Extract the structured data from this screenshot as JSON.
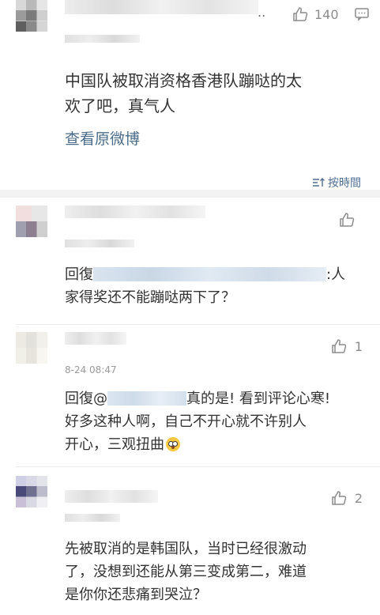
{
  "post": {
    "like_count": "140",
    "ellipsis": "..",
    "text_line1": "中国队被取消资格香港队蹦哒的太",
    "text_line2": "欢了吧，真气人",
    "view_original": "查看原微博",
    "sort_label": "按時間"
  },
  "comments": [
    {
      "like_count": "",
      "reply_prefix": "回復",
      "text_after_mention": ":人",
      "text_line2": "家得奖还不能蹦哒两下了？"
    },
    {
      "date": "8-24 08:47",
      "like_count": "1",
      "reply_prefix": "回復@",
      "text_after_mention": "真的是! 看到评论心寒!",
      "text_line2": "好多这种人啊，自己不开心就不许别人",
      "text_line3": "开心，三观扭曲"
    },
    {
      "like_count": "2",
      "text_line1": "先被取消的是韩国队，当时已经很激动",
      "text_line2": "了，没想到还能从第三变成第二，难道",
      "text_line3": "是你你还悲痛到哭泣？"
    }
  ],
  "icons": {
    "like": "thumbs-up-icon",
    "comment": "comment-icon",
    "sort": "sort-icon",
    "emoji": "flushed-face-icon"
  },
  "colors": {
    "link": "#4a6b8a",
    "sort": "#4f6f93",
    "meta": "#9a9a9a"
  }
}
